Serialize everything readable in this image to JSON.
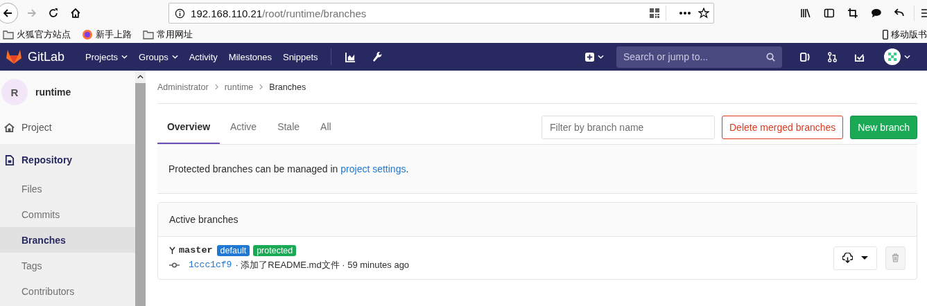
{
  "browser": {
    "url_host": "192.168.110.21",
    "url_path": "/root/runtime/branches",
    "bookmarks": [
      {
        "label": "火狐官方站点",
        "kind": "folder"
      },
      {
        "label": "新手上路",
        "kind": "firefox"
      },
      {
        "label": "常用网址",
        "kind": "folder"
      }
    ],
    "mobile_bookmarks": "移动版书"
  },
  "navbar": {
    "brand": "GitLab",
    "links": [
      {
        "label": "Projects",
        "dropdown": true
      },
      {
        "label": "Groups",
        "dropdown": true
      },
      {
        "label": "Activity",
        "dropdown": false
      },
      {
        "label": "Milestones",
        "dropdown": false
      },
      {
        "label": "Snippets",
        "dropdown": false
      }
    ],
    "search": {
      "placeholder": "Search or jump to..."
    }
  },
  "sidebar": {
    "project": {
      "avatar": "R",
      "name": "runtime"
    },
    "items": [
      {
        "label": "Project",
        "selected": false
      },
      {
        "label": "Repository",
        "selected": true,
        "children": [
          {
            "label": "Files",
            "selected": false
          },
          {
            "label": "Commits",
            "selected": false
          },
          {
            "label": "Branches",
            "selected": true
          },
          {
            "label": "Tags",
            "selected": false
          },
          {
            "label": "Contributors",
            "selected": false
          }
        ]
      }
    ]
  },
  "breadcrumbs": [
    "Administrator",
    "runtime",
    "Branches"
  ],
  "tabs": [
    {
      "label": "Overview",
      "selected": true
    },
    {
      "label": "Active",
      "selected": false
    },
    {
      "label": "Stale",
      "selected": false
    },
    {
      "label": "All",
      "selected": false
    }
  ],
  "filter": {
    "placeholder": "Filter by branch name"
  },
  "buttons": [
    {
      "label": "Delete merged branches",
      "kind": "danger"
    },
    {
      "label": "New branch",
      "kind": "success"
    }
  ],
  "notice": {
    "text": "Protected branches can be managed in ",
    "link": "project settings",
    "after": "."
  },
  "panel": {
    "title": "Active branches",
    "branches": [
      {
        "name": "master",
        "badges": [
          {
            "label": "default",
            "kind": "primary"
          },
          {
            "label": "protected",
            "kind": "success"
          }
        ],
        "sha": "1ccc1cf9",
        "detail": "· 添加了README.md文件 · 59 minutes ago"
      }
    ]
  }
}
